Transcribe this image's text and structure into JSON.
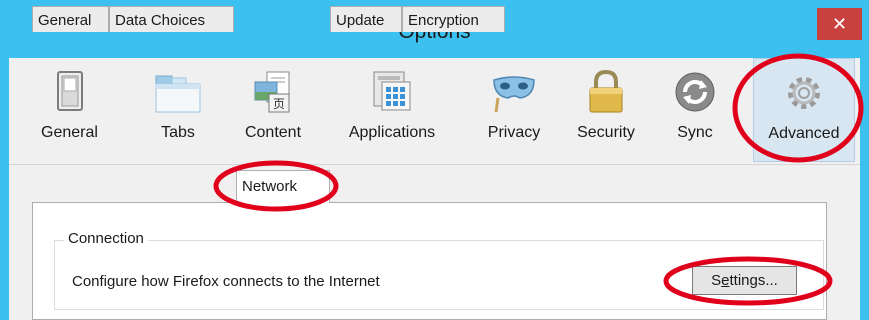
{
  "window": {
    "title": "Options",
    "close_glyph": "✕"
  },
  "toolbar": {
    "items": [
      {
        "label": "General",
        "icon": "switch-icon"
      },
      {
        "label": "Tabs",
        "icon": "tabs-icon"
      },
      {
        "label": "Content",
        "icon": "content-icon"
      },
      {
        "label": "Applications",
        "icon": "applications-icon"
      },
      {
        "label": "Privacy",
        "icon": "mask-icon"
      },
      {
        "label": "Security",
        "icon": "lock-icon"
      },
      {
        "label": "Sync",
        "icon": "sync-icon"
      },
      {
        "label": "Advanced",
        "icon": "gear-icon"
      }
    ],
    "selected": "Advanced"
  },
  "tabs": {
    "items": [
      {
        "label": "General"
      },
      {
        "label": "Data Choices"
      },
      {
        "label": "Network"
      },
      {
        "label": "Update"
      },
      {
        "label": "Encryption"
      }
    ],
    "active": "Network"
  },
  "connection": {
    "title": "Connection",
    "description": "Configure how Firefox connects to the Internet",
    "settings_label_pre": "S",
    "settings_label_key": "e",
    "settings_label_post": "ttings..."
  },
  "colors": {
    "titlebar": "#3bc0ef",
    "close": "#c9413f",
    "annotation": "#e0001b"
  }
}
